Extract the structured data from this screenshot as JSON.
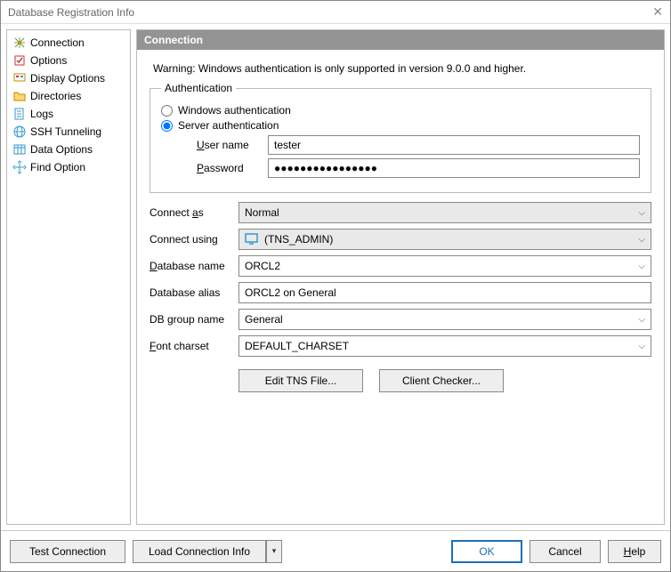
{
  "window": {
    "title": "Database Registration Info"
  },
  "sidebar": {
    "items": [
      {
        "label": "Connection"
      },
      {
        "label": "Options"
      },
      {
        "label": "Display Options"
      },
      {
        "label": "Directories"
      },
      {
        "label": "Logs"
      },
      {
        "label": "SSH Tunneling"
      },
      {
        "label": "Data Options"
      },
      {
        "label": "Find Option"
      }
    ]
  },
  "main": {
    "header": "Connection",
    "warning": "Warning: Windows authentication is only supported in version 9.0.0 and higher.",
    "auth": {
      "legend": "Authentication",
      "opt_windows": "Windows authentication",
      "opt_server": "Server authentication",
      "username_label": "User name",
      "username_value": "tester",
      "password_label": "Password",
      "password_value": "●●●●●●●●●●●●●●●●"
    },
    "fields": {
      "connect_as_label": "Connect as",
      "connect_as_value": "Normal",
      "connect_using_label": "Connect using",
      "connect_using_value": "(TNS_ADMIN)",
      "database_name_label": "Database name",
      "database_name_value": "ORCL2",
      "database_alias_label": "Database alias",
      "database_alias_value": "ORCL2 on General",
      "db_group_label": "DB group name",
      "db_group_value": "General",
      "font_charset_label": "Font charset",
      "font_charset_value": "DEFAULT_CHARSET"
    },
    "buttons": {
      "edit_tns": "Edit TNS File...",
      "client_checker": "Client Checker..."
    }
  },
  "footer": {
    "test_connection": "Test Connection",
    "load_connection": "Load Connection Info",
    "ok": "OK",
    "cancel": "Cancel",
    "help": "Help"
  }
}
